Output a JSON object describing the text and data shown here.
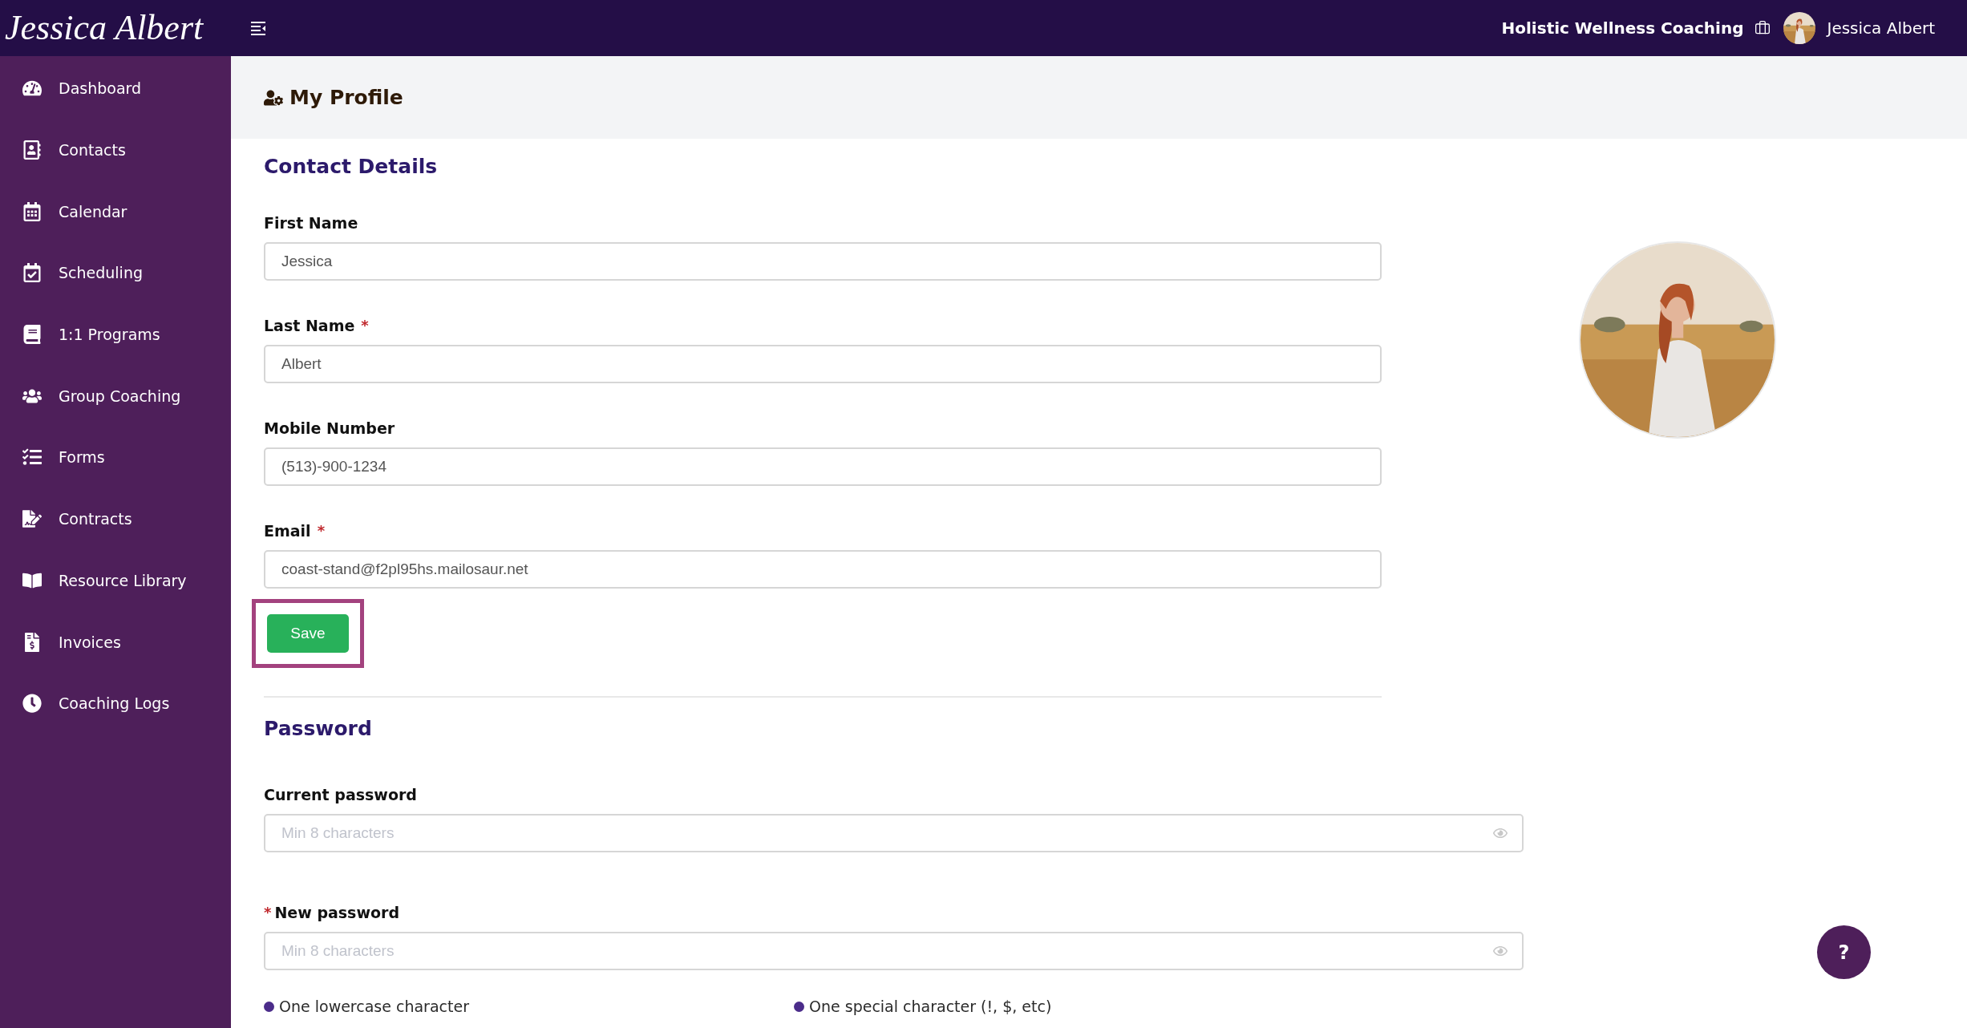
{
  "topbar": {
    "logo": "Jessica Albert",
    "business": "Holistic Wellness Coaching",
    "user": "Jessica Albert"
  },
  "sidebar": {
    "items": [
      {
        "label": "Dashboard"
      },
      {
        "label": "Contacts"
      },
      {
        "label": "Calendar"
      },
      {
        "label": "Scheduling"
      },
      {
        "label": "1:1 Programs"
      },
      {
        "label": "Group Coaching"
      },
      {
        "label": "Forms"
      },
      {
        "label": "Contracts"
      },
      {
        "label": "Resource Library"
      },
      {
        "label": "Invoices"
      },
      {
        "label": "Coaching Logs"
      }
    ]
  },
  "page_title": "My Profile",
  "contact_details": {
    "heading": "Contact Details",
    "fields": [
      {
        "label": "First Name",
        "value": "Jessica"
      },
      {
        "label": "Last Name",
        "required_mark": "*",
        "value": "Albert"
      },
      {
        "label": "Mobile Number",
        "value": "(513)-900-1234"
      },
      {
        "label": "Email",
        "required_mark": "*",
        "value": "coast-stand@f2pl95hs.mailosaur.net"
      }
    ],
    "save_button": {
      "label": "Save",
      "focused": true
    }
  },
  "password": {
    "heading": "Password",
    "fields": [
      {
        "label": "Current password",
        "placeholder": "Min 8 characters"
      },
      {
        "label": "New password",
        "required_mark": "*",
        "placeholder": "Min 8 characters"
      }
    ],
    "requirements": [
      "One lowercase character",
      "One special character (!, $, etc)"
    ]
  },
  "help_button": "?"
}
